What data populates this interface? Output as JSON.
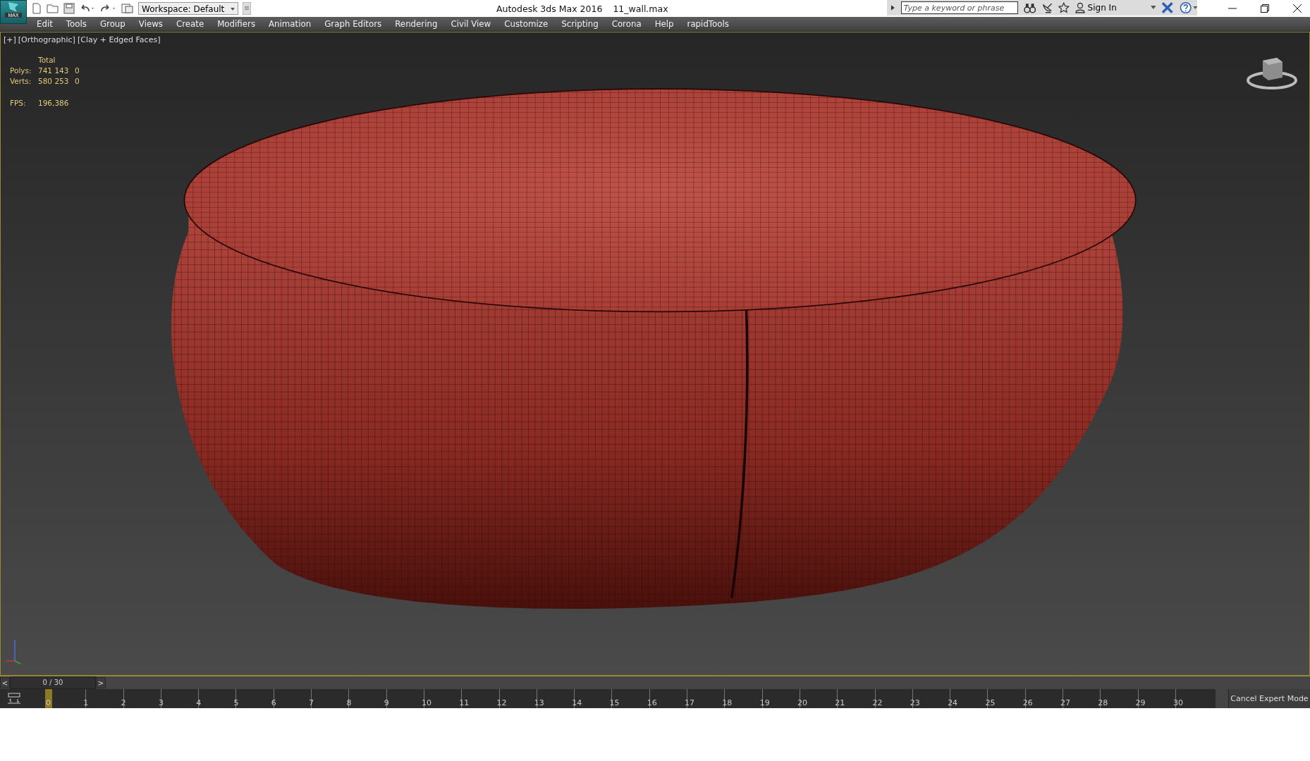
{
  "window": {
    "title": "Autodesk 3ds Max 2016",
    "file": "11_wall.max"
  },
  "app_button": {
    "label": "MAX"
  },
  "workspace": {
    "value": "Workspace: Default"
  },
  "search": {
    "placeholder": "Type a keyword or phrase"
  },
  "sign_in": "Sign In",
  "menu": [
    "Edit",
    "Tools",
    "Group",
    "Views",
    "Create",
    "Modifiers",
    "Animation",
    "Graph Editors",
    "Rendering",
    "Civil View",
    "Customize",
    "Scripting",
    "Corona",
    "Help",
    "rapidTools"
  ],
  "viewport": {
    "labels": [
      "[+]",
      "[Orthographic]",
      "[Clay + Edged Faces]"
    ],
    "stats": {
      "header": "Total",
      "rows": [
        {
          "label": "Polys:",
          "total": "741 143",
          "column_2": "0"
        },
        {
          "label": "Verts:",
          "total": "580 253",
          "column_2": "0"
        }
      ],
      "fps_label": "FPS:",
      "fps": "196,386"
    }
  },
  "time_slider": {
    "prev": "<",
    "frame": "0 / 30",
    "next": ">"
  },
  "track": {
    "ticks": [
      {
        "label": "0",
        "selected": true
      },
      {
        "label": "1",
        "selected": false
      },
      {
        "label": "2",
        "selected": false
      },
      {
        "label": "3",
        "selected": false
      },
      {
        "label": "4",
        "selected": false
      },
      {
        "label": "5",
        "selected": false
      },
      {
        "label": "6",
        "selected": false
      },
      {
        "label": "7",
        "selected": false
      },
      {
        "label": "8",
        "selected": false
      },
      {
        "label": "9",
        "selected": false
      },
      {
        "label": "10",
        "selected": false
      },
      {
        "label": "11",
        "selected": false
      },
      {
        "label": "12",
        "selected": false
      },
      {
        "label": "13",
        "selected": false
      },
      {
        "label": "14",
        "selected": false
      },
      {
        "label": "15",
        "selected": false
      },
      {
        "label": "16",
        "selected": false
      },
      {
        "label": "17",
        "selected": false
      },
      {
        "label": "18",
        "selected": false
      },
      {
        "label": "19",
        "selected": false
      },
      {
        "label": "20",
        "selected": false
      },
      {
        "label": "21",
        "selected": false
      },
      {
        "label": "22",
        "selected": false
      },
      {
        "label": "23",
        "selected": false
      },
      {
        "label": "24",
        "selected": false
      },
      {
        "label": "25",
        "selected": false
      },
      {
        "label": "26",
        "selected": false
      },
      {
        "label": "27",
        "selected": false
      },
      {
        "label": "28",
        "selected": false
      },
      {
        "label": "29",
        "selected": false
      },
      {
        "label": "30",
        "selected": false
      }
    ]
  },
  "expert_mode_button": "Cancel Expert Mode"
}
